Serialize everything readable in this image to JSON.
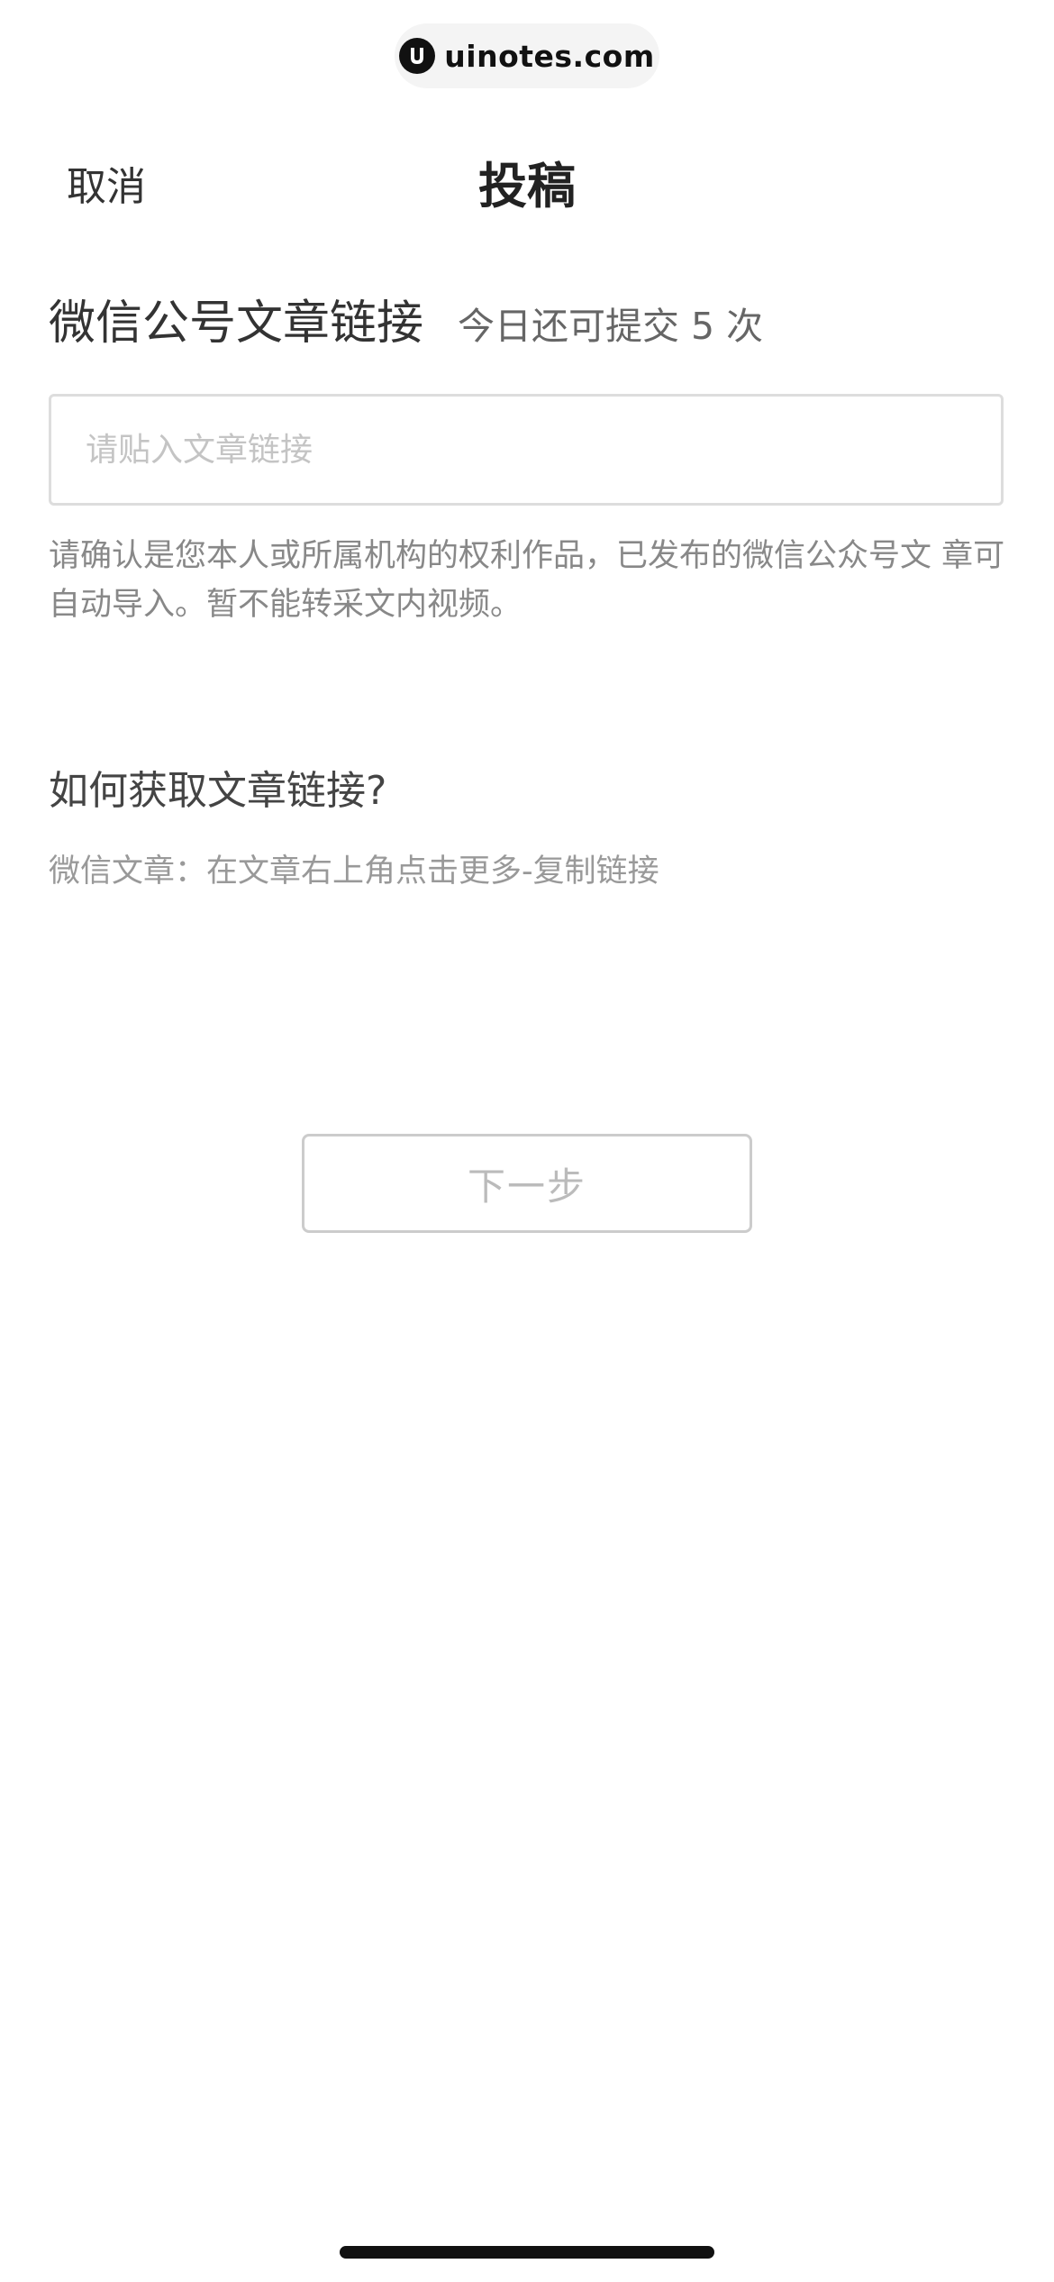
{
  "watermark": {
    "text": "uinotes.com",
    "icon": "uinotes-logo-icon"
  },
  "nav": {
    "cancel_label": "取消",
    "title": "投稿"
  },
  "section": {
    "title": "微信公号文章链接",
    "quota": "今日还可提交 5 次"
  },
  "link_input": {
    "value": "",
    "placeholder": "请贴入文章链接"
  },
  "notice": "请确认是您本人或所属机构的权利作品，已发布的微信公众号文 章可自动导入。暂不能转采文内视频。",
  "howto": {
    "title": "如何获取文章链接?",
    "desc": "微信文章：在文章右上角点击更多-复制链接"
  },
  "next_button": {
    "label": "下一步",
    "state": "disabled"
  },
  "colors": {
    "background": "#ffffff",
    "text_primary": "#333333",
    "text_secondary": "#888888",
    "border": "#dddddd",
    "button_disabled_text": "#bbbbbb"
  }
}
